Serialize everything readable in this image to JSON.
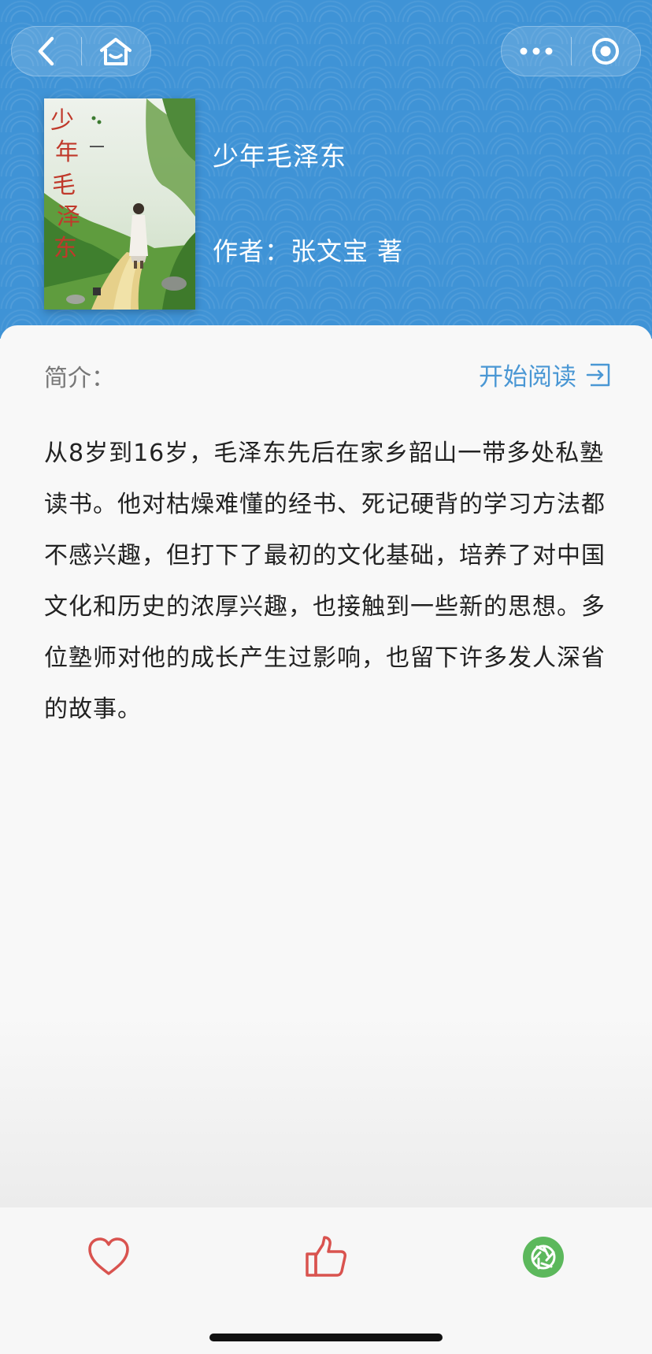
{
  "nav": {
    "back_icon": "chevron-left-icon",
    "home_icon": "home-icon",
    "more_icon": "more-dots-icon",
    "close_icon": "target-circle-icon"
  },
  "book": {
    "title": "少年毛泽东",
    "author": "作者：张文宝 著",
    "cover_title_text": "少年毛泽东"
  },
  "detail": {
    "intro_label": "简介：",
    "start_reading_label": "开始阅读",
    "start_reading_icon": "enter-icon",
    "summary": "从8岁到16岁，毛泽东先后在家乡韶山一带多处私塾读书。他对枯燥难懂的经书、死记硬背的学习方法都不感兴趣，但打下了最初的文化基础，培养了对中国文化和历史的浓厚兴趣，也接触到一些新的思想。多位塾师对他的成长产生过影响，也留下许多发人深省的故事。"
  },
  "bottom_bar": {
    "favorite_icon": "heart-icon",
    "like_icon": "thumbs-up-icon",
    "share_icon": "shutter-icon"
  },
  "colors": {
    "header_blue": "#3f93d6",
    "accent_blue": "#4a97d4",
    "icon_red": "#d9534f",
    "share_green": "#5cb85c"
  }
}
